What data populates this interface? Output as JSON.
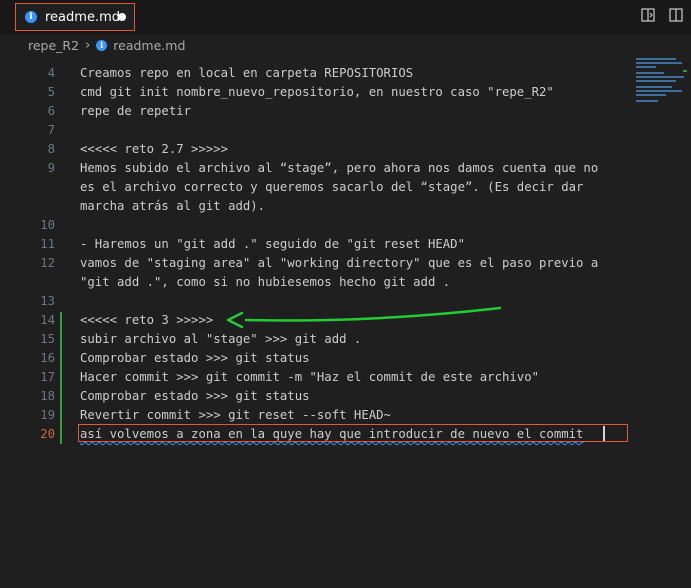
{
  "tab": {
    "filename": "readme.md",
    "icon": "info-icon",
    "unsaved": true
  },
  "breadcrumb": {
    "folder": "repe_R2",
    "file": "readme.md"
  },
  "editor": {
    "current_line": "20",
    "lines": [
      {
        "num": "4",
        "text": "Creamos repo en local en carpeta REPOSITORIOS"
      },
      {
        "num": "5",
        "text": "cmd git init nombre_nuevo_repositorio, en nuestro caso \"repe_R2\""
      },
      {
        "num": "6",
        "text": "repe de repetir"
      },
      {
        "num": "7",
        "text": ""
      },
      {
        "num": "8",
        "text": "<<<<< reto 2.7 >>>>>"
      },
      {
        "num": "9",
        "text": "Hemos subido el archivo al “stage”, pero ahora nos damos cuenta que no"
      },
      {
        "num": "",
        "text": "es el archivo correcto y queremos sacarlo del “stage”. (Es decir dar"
      },
      {
        "num": "",
        "text": "marcha atrás al git add)."
      },
      {
        "num": "10",
        "text": ""
      },
      {
        "num": "11",
        "text": "- Haremos un \"git add .\" seguido de \"git reset HEAD\""
      },
      {
        "num": "12",
        "text": "vamos de \"staging area\" al \"working directory\" que es el paso previo a"
      },
      {
        "num": "",
        "text": "\"git add .\", como si no hubiesemos hecho git add ."
      },
      {
        "num": "13",
        "text": ""
      },
      {
        "num": "14",
        "text": "<<<<< reto 3 >>>>>"
      },
      {
        "num": "15",
        "text": "subir archivo al \"stage\" >>> git add ."
      },
      {
        "num": "16",
        "text": "Comprobar estado >>> git status"
      },
      {
        "num": "17",
        "text": "Hacer commit >>> git commit -m \"Haz el commit de este archivo\""
      },
      {
        "num": "18",
        "text": "Comprobar estado >>> git status"
      },
      {
        "num": "19",
        "text": "Revertir commit >>> git reset --soft HEAD~"
      },
      {
        "num": "20",
        "text": "así volvemos a zona en la quye hay que introducir de nuevo el commit"
      }
    ]
  },
  "colors": {
    "annotation_arrow": "#22cc33",
    "active_border": "#e05a3a",
    "squiggle": "#3794ff"
  }
}
